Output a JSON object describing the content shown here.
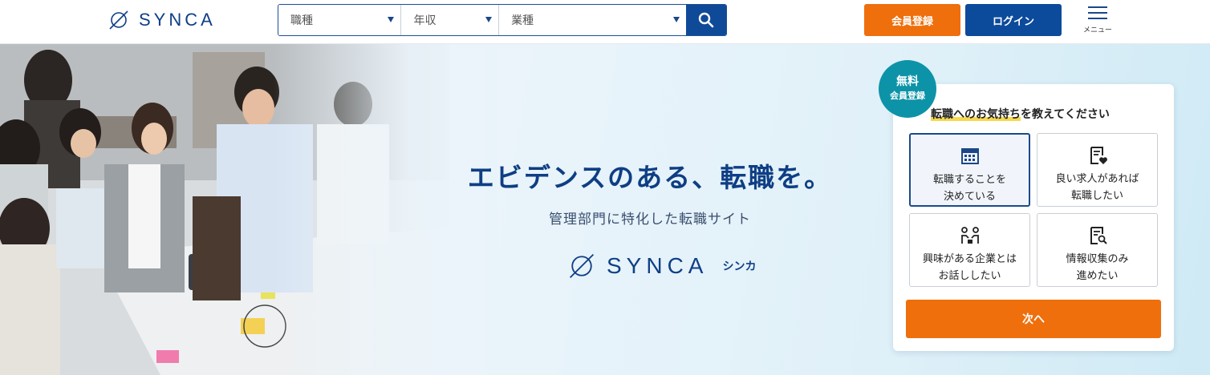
{
  "header": {
    "logo_text": "SYNCA",
    "search": {
      "job_type": "職種",
      "salary": "年収",
      "industry": "業種"
    },
    "register_label": "会員登録",
    "login_label": "ログイン",
    "menu_label": "メニュー"
  },
  "hero": {
    "title": "エビデンスのある、転職を。",
    "subtitle": "管理部門に特化した転職サイト",
    "logo_text": "SYNCA",
    "logo_kana": "シンカ"
  },
  "form": {
    "badge_line1": "無料",
    "badge_line2": "会員登録",
    "question_highlight": "転職へのお気持ち",
    "question_rest": "を教えてください",
    "options": [
      {
        "label": "転職することを\n決めている",
        "icon": "calendar-icon",
        "selected": true
      },
      {
        "label": "良い求人があれば\n転職したい",
        "icon": "heart-document-icon",
        "selected": false
      },
      {
        "label": "興味がある企業とは\nお話ししたい",
        "icon": "meeting-icon",
        "selected": false
      },
      {
        "label": "情報収集のみ\n進めたい",
        "icon": "search-document-icon",
        "selected": false
      }
    ],
    "next_label": "次へ"
  },
  "colors": {
    "brand_blue": "#0e4a98",
    "accent_orange": "#ee6f0c",
    "badge_teal": "#0d93a8"
  }
}
